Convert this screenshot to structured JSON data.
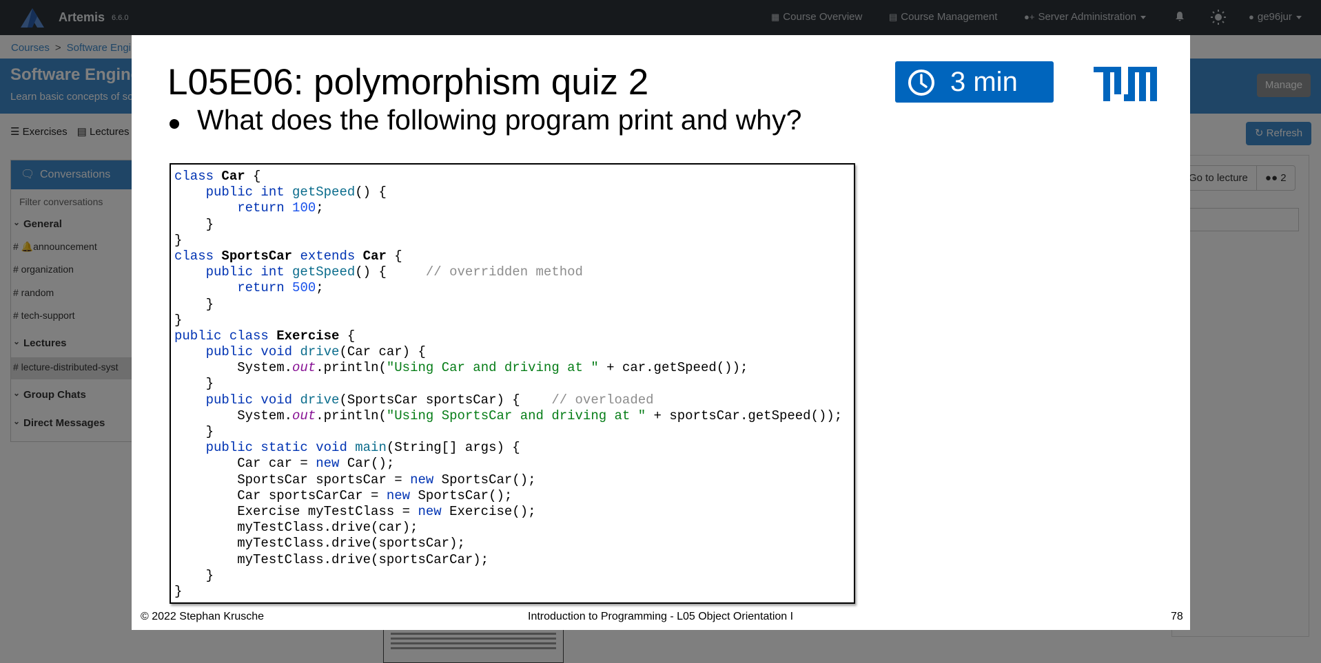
{
  "navbar": {
    "app_name": "Artemis",
    "version": "6.6.0",
    "course_overview": "Course Overview",
    "course_management": "Course Management",
    "server_admin": "Server Administration",
    "user": "ge96jur",
    "icons": [
      "artemis-logo-icon",
      "grid-icon",
      "table-icon",
      "user-plus-icon",
      "bell-icon",
      "sun-icon",
      "user-icon"
    ]
  },
  "breadcrumb": {
    "root": "Courses",
    "sep": ">",
    "course": "Software Engin"
  },
  "course_header": {
    "title": "Software Engine",
    "subtitle": "Learn basic concepts of so",
    "manage": "Manage",
    "color": "#3e8acc"
  },
  "tabs": {
    "exercises": "Exercises",
    "lectures": "Lectures",
    "refresh": "Refresh"
  },
  "sidebar": {
    "header": "Conversations",
    "filter_placeholder": "Filter conversations",
    "general": "General",
    "channels": [
      "# 🔔announcement",
      "# organization",
      "# random",
      "# tech-support"
    ],
    "lectures": "Lectures",
    "lecture_channel": "# lecture-distributed-syst",
    "group_chats": "Group Chats",
    "direct_messages": "Direct Messages"
  },
  "right_tools": {
    "go_to_lecture": "Go to lecture",
    "members": "2"
  },
  "slide": {
    "title": "L05E06: polymorphism quiz 2",
    "timer": "3 min",
    "timer_color": "#0065bd",
    "bullet": "What does the following program print and why?",
    "footer_left": "© 2022 Stephan Krusche",
    "footer_mid": "Introduction to Programming - L05 Object Orientation I",
    "page_number": "78",
    "code": [
      [
        [
          "kw",
          "class "
        ],
        [
          "cls",
          "Car"
        ],
        [
          "p",
          " {"
        ]
      ],
      [
        [
          "p",
          "    "
        ],
        [
          "kw",
          "public int "
        ],
        [
          "fn",
          "getSpeed"
        ],
        [
          "p",
          "() {"
        ]
      ],
      [
        [
          "p",
          "        "
        ],
        [
          "kw",
          "return "
        ],
        [
          "num",
          "100"
        ],
        [
          "p",
          ";"
        ]
      ],
      [
        [
          "p",
          "    }"
        ]
      ],
      [
        [
          "p",
          "}"
        ]
      ],
      [
        [
          "kw",
          "class "
        ],
        [
          "cls",
          "SportsCar"
        ],
        [
          "kw",
          " extends "
        ],
        [
          "cls",
          "Car"
        ],
        [
          "p",
          " {"
        ]
      ],
      [
        [
          "p",
          "    "
        ],
        [
          "kw",
          "public int "
        ],
        [
          "fn",
          "getSpeed"
        ],
        [
          "p",
          "() {     "
        ],
        [
          "cm",
          "// overridden method"
        ]
      ],
      [
        [
          "p",
          "        "
        ],
        [
          "kw",
          "return "
        ],
        [
          "num",
          "500"
        ],
        [
          "p",
          ";"
        ]
      ],
      [
        [
          "p",
          "    }"
        ]
      ],
      [
        [
          "p",
          "}"
        ]
      ],
      [
        [
          "kw",
          "public class "
        ],
        [
          "cls",
          "Exercise"
        ],
        [
          "p",
          " {"
        ]
      ],
      [
        [
          "p",
          "    "
        ],
        [
          "kw",
          "public void "
        ],
        [
          "fn",
          "drive"
        ],
        [
          "p",
          "(Car car) {"
        ]
      ],
      [
        [
          "p",
          "        System."
        ],
        [
          "it",
          "out"
        ],
        [
          "p",
          ".println("
        ],
        [
          "str",
          "\"Using Car and driving at \""
        ],
        [
          "p",
          " + car.getSpeed());"
        ]
      ],
      [
        [
          "p",
          "    }"
        ]
      ],
      [
        [
          "p",
          "    "
        ],
        [
          "kw",
          "public void "
        ],
        [
          "fn",
          "drive"
        ],
        [
          "p",
          "(SportsCar sportsCar) {    "
        ],
        [
          "cm",
          "// overloaded"
        ]
      ],
      [
        [
          "p",
          "        System."
        ],
        [
          "it",
          "out"
        ],
        [
          "p",
          ".println("
        ],
        [
          "str",
          "\"Using SportsCar and driving at \""
        ],
        [
          "p",
          " + sportsCar.getSpeed());"
        ]
      ],
      [
        [
          "p",
          "    }"
        ]
      ],
      [
        [
          "p",
          "    "
        ],
        [
          "kw",
          "public static void "
        ],
        [
          "fn",
          "main"
        ],
        [
          "p",
          "(String[] args) {"
        ]
      ],
      [
        [
          "p",
          "        Car car = "
        ],
        [
          "kw",
          "new "
        ],
        [
          "p",
          "Car();"
        ]
      ],
      [
        [
          "p",
          "        SportsCar sportsCar = "
        ],
        [
          "kw",
          "new "
        ],
        [
          "p",
          "SportsCar();"
        ]
      ],
      [
        [
          "p",
          "        Car sportsCarCar = "
        ],
        [
          "kw",
          "new "
        ],
        [
          "p",
          "SportsCar();"
        ]
      ],
      [
        [
          "p",
          "        Exercise myTestClass = "
        ],
        [
          "kw",
          "new "
        ],
        [
          "p",
          "Exercise();"
        ]
      ],
      [
        [
          "p",
          "        myTestClass.drive(car);"
        ]
      ],
      [
        [
          "p",
          "        myTestClass.drive(sportsCar);"
        ]
      ],
      [
        [
          "p",
          "        myTestClass.drive(sportsCarCar);"
        ]
      ],
      [
        [
          "p",
          "    }"
        ]
      ],
      [
        [
          "p",
          "}"
        ]
      ]
    ]
  }
}
